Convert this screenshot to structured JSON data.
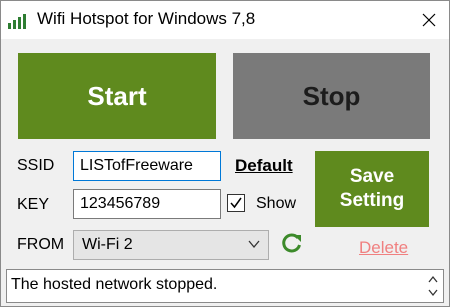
{
  "window": {
    "title": "Wifi Hotspot for Windows 7,8",
    "close_icon": "close-icon"
  },
  "buttons": {
    "start": "Start",
    "stop": "Stop",
    "save_line1": "Save",
    "save_line2": "Setting"
  },
  "form": {
    "ssid_label": "SSID",
    "ssid_value": "LISTofFreeware",
    "key_label": "KEY",
    "key_value": "123456789",
    "from_label": "FROM",
    "from_value": "Wi-Fi 2",
    "default_link": "Default",
    "show_label": "Show",
    "show_checked": true,
    "delete_link": "Delete"
  },
  "status": {
    "text": "The hosted network stopped."
  },
  "colors": {
    "green": "#5f8a1e",
    "gray": "#7a7a7a",
    "delete": "#f08080",
    "refresh": "#3c8a2a"
  }
}
